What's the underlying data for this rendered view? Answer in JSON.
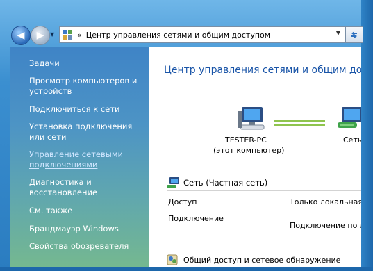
{
  "address_bar": {
    "breadcrumb_separator": "«",
    "path": "Центр управления сетями и общим доступом"
  },
  "sidebar": {
    "items": [
      {
        "label": "Задачи"
      },
      {
        "label": "Просмотр компьютеров и устройств"
      },
      {
        "label": "Подключиться к сети"
      },
      {
        "label": "Установка подключения или сети"
      },
      {
        "label": "Управление сетевыми подключениями"
      },
      {
        "label": "Диагностика и восстановление"
      },
      {
        "label": "См. также"
      },
      {
        "label": "Брандмауэр Windows"
      },
      {
        "label": "Свойства обозревателя"
      }
    ]
  },
  "main": {
    "title": "Центр управления сетями и общим досту",
    "computer": {
      "name": "TESTER-PC",
      "subtitle": "(этот компьютер)"
    },
    "network_node": {
      "name": "Сеть"
    },
    "network": {
      "header": "Сеть (Частная сеть)",
      "rows": [
        {
          "label": "Доступ",
          "value": "Только локальная"
        },
        {
          "label": "Подключение",
          "value": "Подключение по л"
        }
      ]
    },
    "sharing_section": "Общий доступ и сетевое обнаружение"
  }
}
